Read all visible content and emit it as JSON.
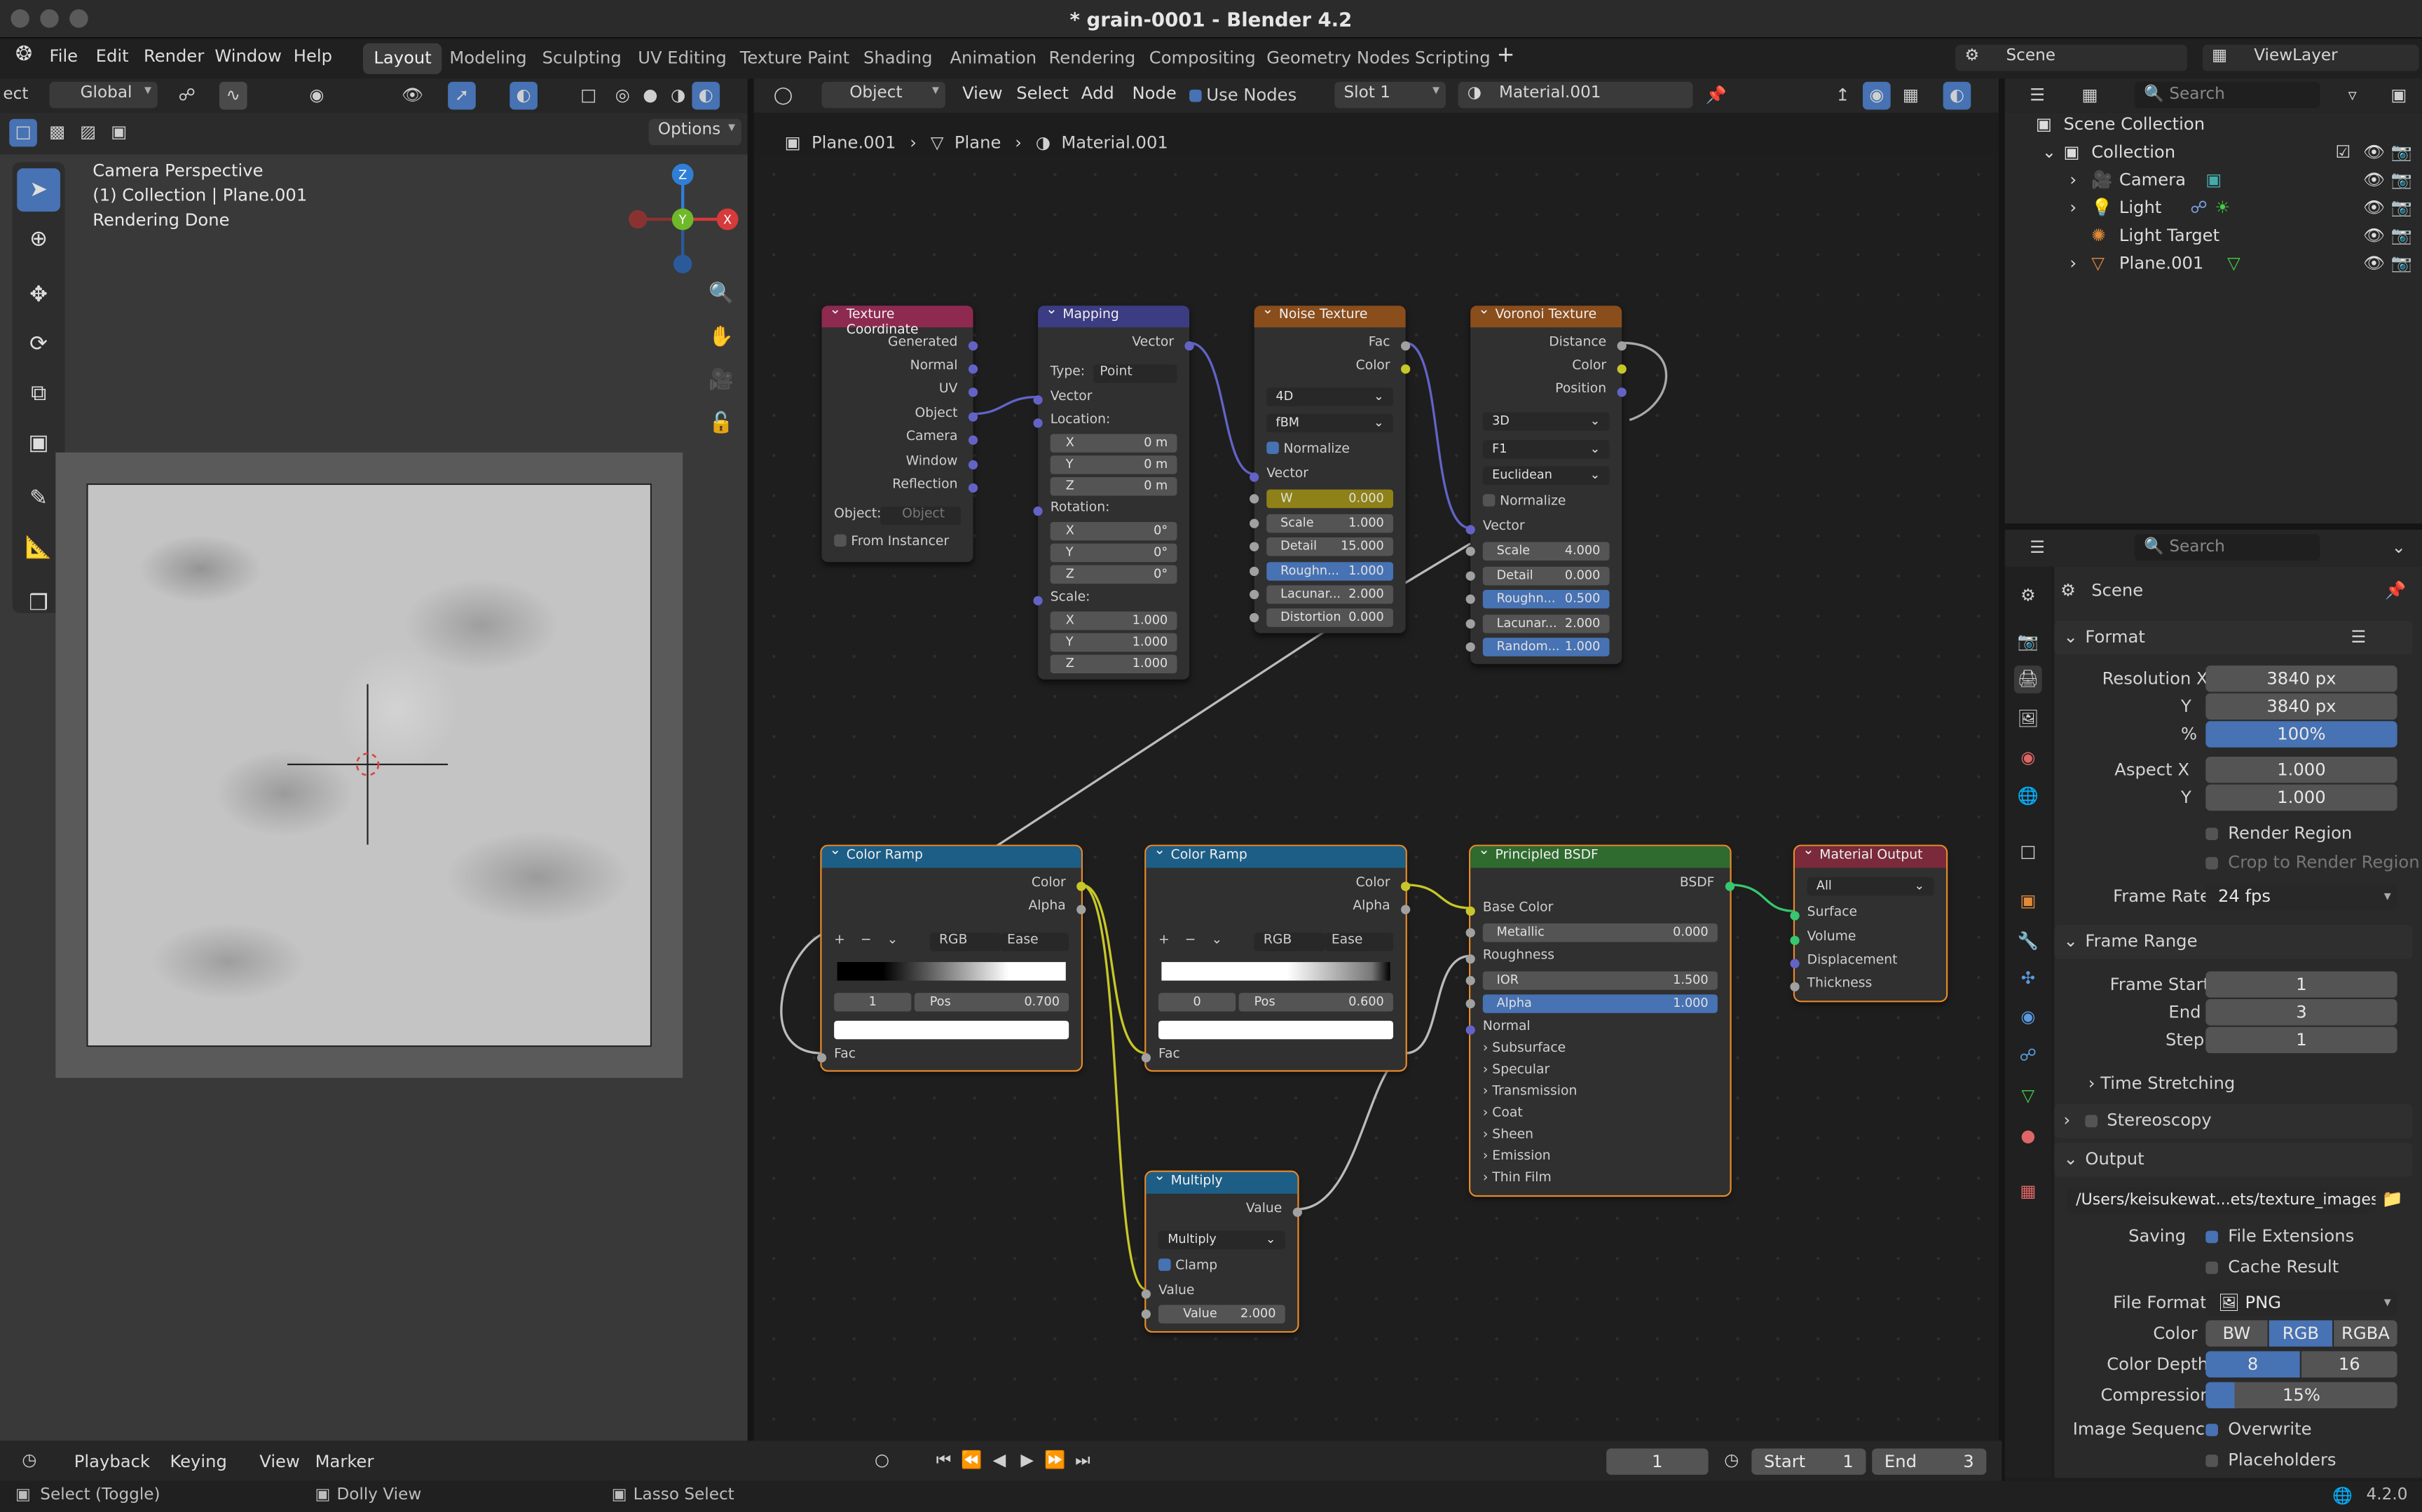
{
  "window": {
    "title": "* grain-0001 - Blender 4.2"
  },
  "menu": {
    "items": [
      "File",
      "Edit",
      "Render",
      "Window",
      "Help"
    ]
  },
  "workspaces": [
    "Layout",
    "Modeling",
    "Sculpting",
    "UV Editing",
    "Texture Paint",
    "Shading",
    "Animation",
    "Rendering",
    "Compositing",
    "Geometry Nodes",
    "Scripting"
  ],
  "scene": {
    "scene_name": "Scene",
    "view_layer": "ViewLayer"
  },
  "viewport": {
    "mode_fragment": "ect",
    "orientation": "Global",
    "options": "Options",
    "overlay_line1": "Camera Perspective",
    "overlay_line2": "(1) Collection | Plane.001",
    "overlay_line3": "Rendering Done",
    "gizmo_z": "Z",
    "gizmo_y": "Y",
    "gizmo_x": "X"
  },
  "node_header": {
    "mode": "Object",
    "menu": [
      "View",
      "Select",
      "Add",
      "Node"
    ],
    "use_nodes": "Use Nodes",
    "slot": "Slot 1",
    "material": "Material.001"
  },
  "breadcrumb": [
    "Plane.001",
    "Plane",
    "Material.001"
  ],
  "nodes": {
    "tex_coord": {
      "title": "Texture Coordinate",
      "outputs": [
        "Generated",
        "Normal",
        "UV",
        "Object",
        "Camera",
        "Window",
        "Reflection"
      ],
      "object_label": "Object:",
      "object_placeholder": "Object",
      "from_instancer": "From Instancer"
    },
    "mapping": {
      "title": "Mapping",
      "out": "Vector",
      "type_label": "Type:",
      "type": "Point",
      "vector": "Vector",
      "location": "Location:",
      "rotation": "Rotation:",
      "scale": "Scale:",
      "loc": [
        [
          "X",
          "0 m"
        ],
        [
          "Y",
          "0 m"
        ],
        [
          "Z",
          "0 m"
        ]
      ],
      "rot": [
        [
          "X",
          "0°"
        ],
        [
          "Y",
          "0°"
        ],
        [
          "Z",
          "0°"
        ]
      ],
      "scl": [
        [
          "X",
          "1.000"
        ],
        [
          "Y",
          "1.000"
        ],
        [
          "Z",
          "1.000"
        ]
      ]
    },
    "noise": {
      "title": "Noise Texture",
      "out_fac": "Fac",
      "out_color": "Color",
      "dim": "4D",
      "type": "fBM",
      "normalize": "Normalize",
      "vector": "Vector",
      "fields": [
        [
          "W",
          "0.000"
        ],
        [
          "Scale",
          "1.000"
        ],
        [
          "Detail",
          "15.000"
        ],
        [
          "Roughn...",
          "1.000"
        ],
        [
          "Lacunar...",
          "2.000"
        ],
        [
          "Distortion",
          "0.000"
        ]
      ]
    },
    "voronoi": {
      "title": "Voronoi Texture",
      "outputs": [
        "Distance",
        "Color",
        "Position"
      ],
      "dim": "3D",
      "feature": "F1",
      "metric": "Euclidean",
      "normalize": "Normalize",
      "vector": "Vector",
      "fields": [
        [
          "Scale",
          "4.000"
        ],
        [
          "Detail",
          "0.000"
        ],
        [
          "Roughn...",
          "0.500"
        ],
        [
          "Lacunar...",
          "2.000"
        ],
        [
          "Random...",
          "1.000"
        ]
      ]
    },
    "ramp1": {
      "title": "Color Ramp",
      "out_color": "Color",
      "out_alpha": "Alpha",
      "mode": "RGB",
      "interp": "Ease",
      "index": "1",
      "pos_label": "Pos",
      "pos": "0.700",
      "fac": "Fac"
    },
    "ramp2": {
      "title": "Color Ramp",
      "out_color": "Color",
      "out_alpha": "Alpha",
      "mode": "RGB",
      "interp": "Ease",
      "index": "0",
      "pos_label": "Pos",
      "pos": "0.600",
      "fac": "Fac"
    },
    "bsdf": {
      "title": "Principled BSDF",
      "out": "BSDF",
      "base_color": "Base Color",
      "metallic": "Metallic",
      "metallic_v": "0.000",
      "roughness": "Roughness",
      "ior": "IOR",
      "ior_v": "1.500",
      "alpha": "Alpha",
      "alpha_v": "1.000",
      "normal": "Normal",
      "panels": [
        "Subsurface",
        "Specular",
        "Transmission",
        "Coat",
        "Sheen",
        "Emission",
        "Thin Film"
      ]
    },
    "output": {
      "title": "Material Output",
      "target": "All",
      "inputs": [
        "Surface",
        "Volume",
        "Displacement",
        "Thickness"
      ]
    },
    "multiply": {
      "title": "Multiply",
      "out": "Value",
      "op": "Multiply",
      "clamp": "Clamp",
      "value_in": "Value",
      "value_label": "Value",
      "value": "2.000"
    }
  },
  "outliner": {
    "search": "Search",
    "rows": [
      "Scene Collection",
      "Collection",
      "Camera",
      "Light",
      "Light Target",
      "Plane.001"
    ]
  },
  "properties": {
    "search": "Search",
    "context": "Scene",
    "format": "Format",
    "res_x_label": "Resolution X",
    "res_x": "3840 px",
    "res_y_label": "Y",
    "res_y": "3840 px",
    "pct_label": "%",
    "pct": "100%",
    "aspect_x_label": "Aspect X",
    "aspect_x": "1.000",
    "aspect_y_label": "Y",
    "aspect_y": "1.000",
    "render_region": "Render Region",
    "crop": "Crop to Render Region",
    "frame_rate_label": "Frame Rate",
    "frame_rate": "24 fps",
    "frame_range": "Frame Range",
    "frame_start_label": "Frame Start",
    "frame_start": "1",
    "end_label": "End",
    "end": "3",
    "step_label": "Step",
    "step": "1",
    "time_stretching": "Time Stretching",
    "stereoscopy": "Stereoscopy",
    "output": "Output",
    "path": "/Users/keisukewat...ets/texture_images/",
    "saving_label": "Saving",
    "file_ext": "File Extensions",
    "cache_result": "Cache Result",
    "file_format_label": "File Format",
    "file_format": "PNG",
    "color_label": "Color",
    "color_opts": [
      "BW",
      "RGB",
      "RGBA"
    ],
    "depth_label": "Color Depth",
    "depth_opts": [
      "8",
      "16"
    ],
    "compression_label": "Compression",
    "compression": "15%",
    "image_seq_label": "Image Sequence",
    "overwrite": "Overwrite",
    "placeholders": "Placeholders"
  },
  "timeline": {
    "playback": "Playback",
    "keying": "Keying",
    "view": "View",
    "marker": "Marker",
    "current": "1",
    "start_label": "Start",
    "start": "1",
    "end_label": "End",
    "end": "3"
  },
  "status": {
    "select": "Select (Toggle)",
    "dolly": "Dolly View",
    "lasso": "Lasso Select",
    "version": "4.2.0"
  }
}
